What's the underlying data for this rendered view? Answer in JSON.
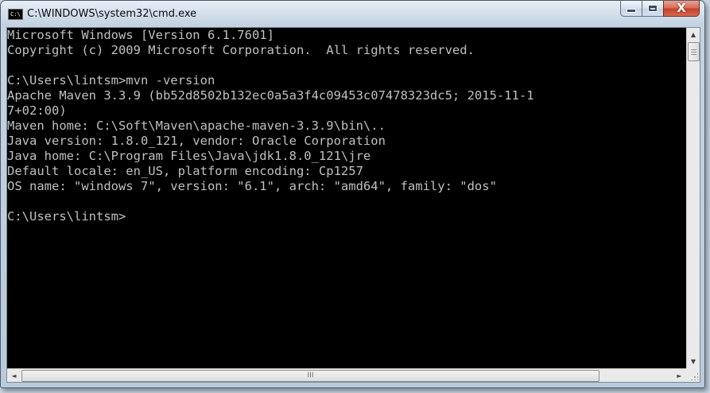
{
  "window": {
    "title": "C:\\WINDOWS\\system32\\cmd.exe",
    "icon_label": "C:\\",
    "controls": {
      "minimize_icon": "minimize-icon",
      "maximize_icon": "maximize-icon",
      "close_glyph": "X"
    }
  },
  "console": {
    "background": "#000000",
    "foreground": "#c0c0c0",
    "lines": [
      "Microsoft Windows [Version 6.1.7601]",
      "Copyright (c) 2009 Microsoft Corporation.  All rights reserved.",
      "",
      "C:\\Users\\lintsm>mvn -version",
      "Apache Maven 3.3.9 (bb52d8502b132ec0a5a3f4c09453c07478323dc5; 2015-11-1",
      "7+02:00)",
      "Maven home: C:\\Soft\\Maven\\apache-maven-3.3.9\\bin\\..",
      "Java version: 1.8.0_121, vendor: Oracle Corporation",
      "Java home: C:\\Program Files\\Java\\jdk1.8.0_121\\jre",
      "Default locale: en_US, platform encoding: Cp1257",
      "OS name: \"windows 7\", version: \"6.1\", arch: \"amd64\", family: \"dos\"",
      "",
      "C:\\Users\\lintsm>"
    ]
  },
  "scrollbars": {
    "up_arrow": "▲",
    "down_arrow": "▼",
    "left_arrow": "◄",
    "right_arrow": "►",
    "h_thumb_grip": "III"
  }
}
